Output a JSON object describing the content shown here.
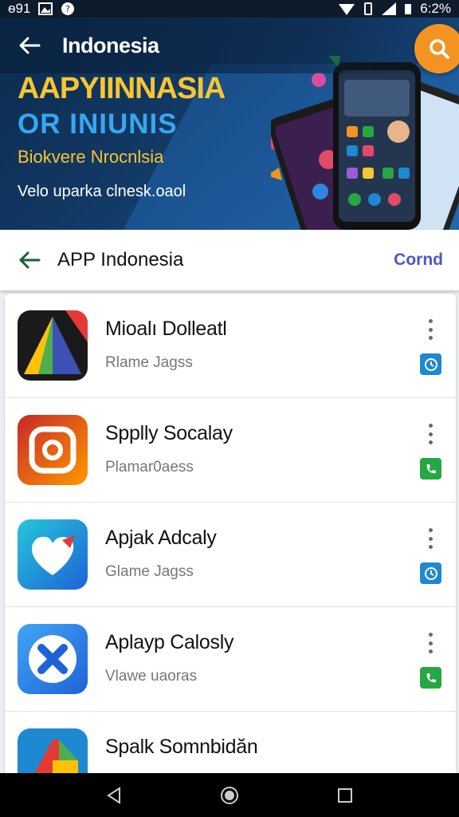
{
  "status_bar": {
    "left_text": "ѳ91",
    "time": "6:2%"
  },
  "header": {
    "title": "Indonesia",
    "back_icon": "arrow-left-icon",
    "search_icon": "search-icon",
    "search_color": "#f39321"
  },
  "promo": {
    "line1": "AAPYIINNASIA",
    "line2": "OR  INIUNIS",
    "line3": "Biokvere Nrocnlsia",
    "line4": "Velo uparka clnesk.oaol"
  },
  "section": {
    "title": "APP Indonesia",
    "action": "Cornd",
    "action_color": "#4b58c7"
  },
  "apps": [
    {
      "name": "Mioalı Dolleatl",
      "subtitle": "Rlame Jagss",
      "badge_icon": "clock-icon",
      "badge_color": "#1e88d0"
    },
    {
      "name": "Spplly Socalay",
      "subtitle": "Plamar0aess",
      "badge_icon": "phone-icon",
      "badge_color": "#27a744"
    },
    {
      "name": "Apjak Adcaly",
      "subtitle": "Glame Jagss",
      "badge_icon": "clock-icon",
      "badge_color": "#1e88d0"
    },
    {
      "name": "Aplayp Calosly",
      "subtitle": "Vlawe uaoras",
      "badge_icon": "phone-icon",
      "badge_color": "#27a744"
    },
    {
      "name": "Spalk Somnbidăn",
      "subtitle": "",
      "badge_icon": "",
      "badge_color": ""
    }
  ],
  "nav": {
    "back": "triangle-back-icon",
    "home": "circle-home-icon",
    "recents": "square-recents-icon"
  }
}
